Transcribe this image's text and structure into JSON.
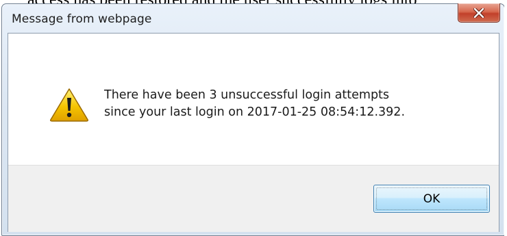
{
  "background": {
    "page_text": "access has been restored and the user successfully logs into"
  },
  "dialog": {
    "title": "Message from webpage",
    "close_icon": "close-icon",
    "icon": "warning-icon",
    "message_lines": [
      "There have been 3 unsuccessful login attempts",
      "since your last login on 2017-01-25 08:54:12.392."
    ],
    "ok_label": "OK"
  },
  "colors": {
    "close_button": "#c2402a",
    "ok_button_border": "#3c7fb1",
    "warning_fill": "#f5c400"
  }
}
